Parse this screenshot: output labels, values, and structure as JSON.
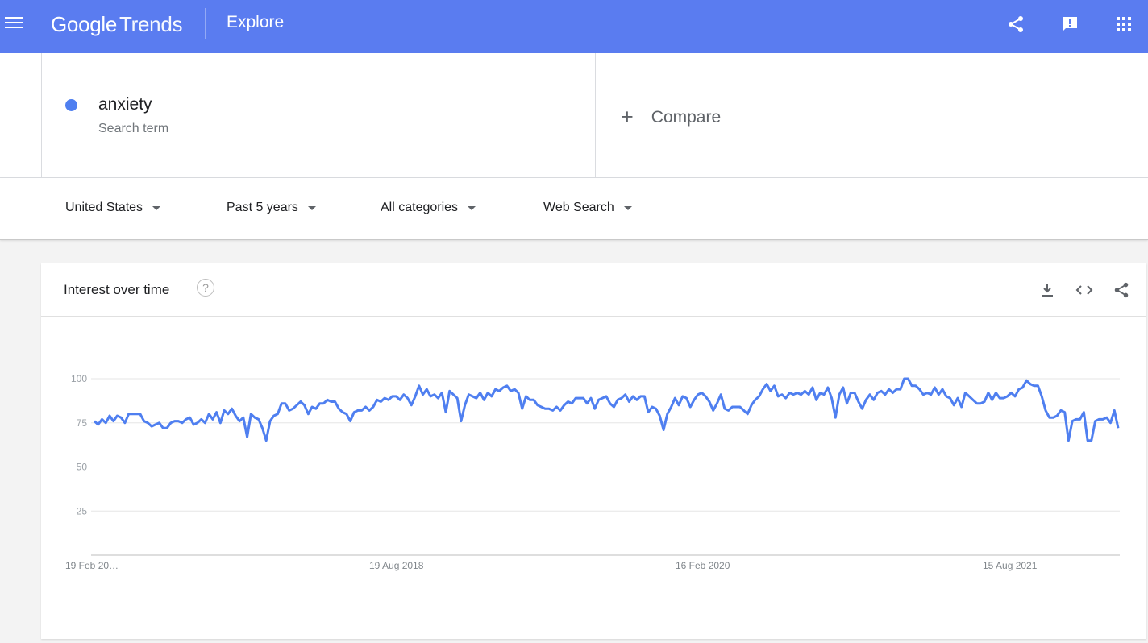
{
  "appbar": {
    "logo_google": "Google",
    "logo_trends": "Trends",
    "title": "Explore",
    "icons": [
      "menu-icon",
      "share-icon",
      "feedback-icon",
      "apps-icon"
    ]
  },
  "term": {
    "name": "anxiety",
    "type": "Search term",
    "color": "#4f7ff0"
  },
  "compare": {
    "plus": "+",
    "label": "Compare"
  },
  "filters": {
    "region": "United States",
    "time": "Past 5 years",
    "category": "All categories",
    "search_type": "Web Search"
  },
  "card": {
    "title": "Interest over time",
    "help": "?",
    "icons": [
      "download-icon",
      "embed-icon",
      "share-icon"
    ]
  },
  "chart_data": {
    "type": "line",
    "title": "Interest over time",
    "xlabel": "",
    "ylabel": "",
    "ylim": [
      0,
      100
    ],
    "y_ticks": [
      "100",
      "75",
      "50",
      "25"
    ],
    "x_ticks": [
      "19 Feb 20…",
      "19 Aug 2018",
      "16 Feb 2020",
      "15 Aug 2021"
    ],
    "grid": true,
    "series": [
      {
        "color": "#4f7ff0",
        "values": [
          76,
          74,
          77,
          75,
          79,
          76,
          79,
          78,
          75,
          80,
          80,
          80,
          80,
          76,
          75,
          73,
          74,
          75,
          72,
          72,
          75,
          76,
          76,
          75,
          77,
          78,
          74,
          75,
          77,
          75,
          80,
          77,
          81,
          75,
          82,
          80,
          83,
          79,
          76,
          78,
          67,
          80,
          78,
          77,
          72,
          65,
          76,
          79,
          80,
          86,
          86,
          82,
          83,
          85,
          87,
          85,
          80,
          84,
          83,
          86,
          86,
          88,
          87,
          87,
          83,
          81,
          80,
          76,
          81,
          82,
          82,
          84,
          82,
          84,
          88,
          87,
          89,
          88,
          90,
          90,
          88,
          91,
          89,
          85,
          90,
          96,
          91,
          94,
          90,
          91,
          89,
          92,
          81,
          93,
          91,
          89,
          76,
          85,
          91,
          90,
          89,
          92,
          88,
          92,
          90,
          94,
          93,
          95,
          96,
          93,
          94,
          92,
          83,
          90,
          88,
          88,
          85,
          84,
          83,
          83,
          82,
          84,
          82,
          85,
          87,
          86,
          89,
          89,
          89,
          86,
          89,
          83,
          88,
          89,
          90,
          86,
          84,
          88,
          89,
          91,
          87,
          90,
          88,
          90,
          90,
          81,
          84,
          83,
          79,
          71,
          80,
          84,
          89,
          85,
          90,
          89,
          84,
          88,
          91,
          92,
          90,
          87,
          82,
          86,
          91,
          83,
          82,
          84,
          84,
          84,
          82,
          80,
          85,
          88,
          90,
          94,
          97,
          93,
          96,
          90,
          91,
          89,
          92,
          91,
          92,
          91,
          93,
          91,
          95,
          88,
          92,
          91,
          95,
          89,
          78,
          91,
          95,
          86,
          92,
          92,
          87,
          83,
          88,
          91,
          88,
          92,
          93,
          91,
          94,
          92,
          94,
          94,
          100,
          100,
          96,
          96,
          94,
          91,
          92,
          91,
          95,
          91,
          94,
          90,
          89,
          85,
          89,
          84,
          92,
          90,
          88,
          86,
          86,
          87,
          92,
          88,
          92,
          89,
          89,
          90,
          92,
          90,
          94,
          95,
          99,
          97,
          96,
          96,
          90,
          82,
          78,
          78,
          79,
          82,
          81,
          65,
          76,
          77,
          77,
          81,
          65,
          65,
          76,
          77,
          77,
          78,
          75,
          82,
          72
        ]
      }
    ]
  }
}
